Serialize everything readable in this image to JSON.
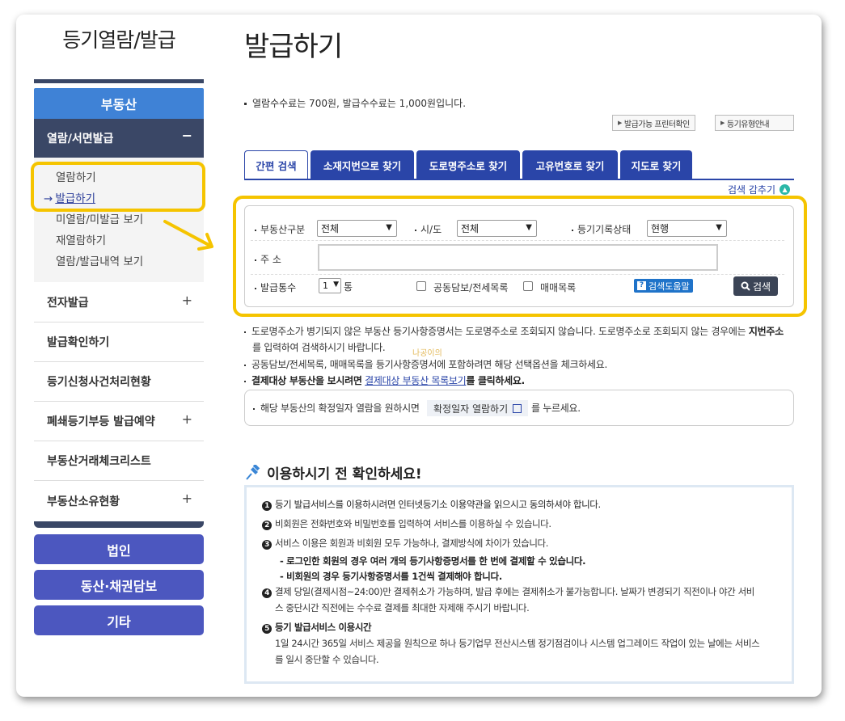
{
  "sidebar": {
    "title": "등기열람/발급",
    "category": "부동산",
    "sub_header": "열람/서면발급",
    "sub_items": [
      "열람하기",
      "발급하기",
      "미열람/미발급 보기",
      "재열람하기",
      "열람/발급내역 보기"
    ],
    "active_index": 1,
    "menu": [
      {
        "label": "전자발급",
        "expand": true
      },
      {
        "label": "발급확인하기",
        "expand": false
      },
      {
        "label": "등기신청사건처리현황",
        "expand": false
      },
      {
        "label": "폐쇄등기부등 발급예약",
        "expand": true
      },
      {
        "label": "부동산거래체크리스트",
        "expand": false
      },
      {
        "label": "부동산소유현황",
        "expand": true
      }
    ],
    "buttons": [
      "법인",
      "동산·채권담보",
      "기타"
    ]
  },
  "main": {
    "title": "발급하기",
    "fee_notice": "열람수수료는 700원, 발급수수료는 1,000원입니다.",
    "link_buttons": [
      "발급가능 프린터확인",
      "등기유형안내"
    ],
    "tabs": [
      "간편 검색",
      "소재지번으로 찾기",
      "도로명주소로 찾기",
      "고유번호로 찾기",
      "지도로 찾기"
    ],
    "active_tab": 0,
    "hide_search": "검색 감추기",
    "form": {
      "property_type_label": "부동산구분",
      "property_type_value": "전체",
      "region_label": "시/도",
      "region_value": "전체",
      "status_label": "등기기록상태",
      "status_value": "현행",
      "address_label": "주 소",
      "address_value": "",
      "copies_label": "발급통수",
      "copies_value": "1",
      "copies_unit": "통",
      "opt1_label": "공동담보/전세목록",
      "opt2_label": "매매목록",
      "help_label": "검색도움말",
      "search_label": "검색"
    },
    "notes": {
      "n1_line1": "도로명주소가 병기되지 않은 부동산 등기사항증명서는 도로명주소로 조회되지 않습니다. 도로명주소로 조회되지 않는 경우에는",
      "n1_bold": "지번주소",
      "n1_line2": "를 입력하여 검색하시기 바랍니다.",
      "n2": "공동담보/전세목록, 매매목록을 등기사항증명서에 포함하려면 해당 선택옵션을 체크하세요.",
      "n3_bold": "결제대상 부동산을 보시려면",
      "n3_link": "결제대상 부동산 목록보기",
      "n3_end": "를 클릭하세요."
    },
    "confirm_note_pre": "해당 부동산의 확정일자 열람을 원하시면",
    "confirm_btn": "확정일자 열람하기",
    "confirm_note_post": "를 누르세요.",
    "watermark": "나공이의",
    "check_title": "이용하시기 전 확인하세요!",
    "check_items": {
      "i1": "등기 발급서비스를 이용하시려면 인터넷등기소 이용약관을 읽으시고 동의하셔야 합니다.",
      "i2": "비회원은 전화번호와 비밀번호를 입력하여 서비스를 이용하실 수 있습니다.",
      "i3": "서비스 이용은 회원과 비회원 모두 가능하나, 결제방식에 차이가 있습니다.",
      "i3a": "- 로그인한 회원의 경우 여러 개의 등기사항증명서를 한 번에 결제할 수 있습니다.",
      "i3b": "- 비회원의 경우 등기사항증명서를 1건씩 결제해야 합니다.",
      "i4a": "결제 당일(결제시점~24:00)만 결제취소가 가능하며, 발급 후에는 결제취소가 불가능합니다. 날짜가 변경되기 직전이나 야간 서비",
      "i4b": "스 중단시간 직전에는 수수료 결제를 최대한 자제해 주시기 바랍니다.",
      "i5": "등기 발급서비스 이용시간",
      "i5a": "1일 24시간 365일 서비스 제공을 원칙으로 하나 등기업무 전산시스템 정기점검이나 시스템 업그레이드 작업이 있는 날에는 서비스",
      "i5b": "를 일시 중단할 수 있습니다."
    },
    "numbers": [
      "1",
      "2",
      "3",
      "4",
      "5"
    ]
  },
  "colors": {
    "accent_blue": "#2a45a8",
    "nav_dark": "#3a4766",
    "highlight": "#f5c400",
    "category_blue": "#3f82d6"
  }
}
